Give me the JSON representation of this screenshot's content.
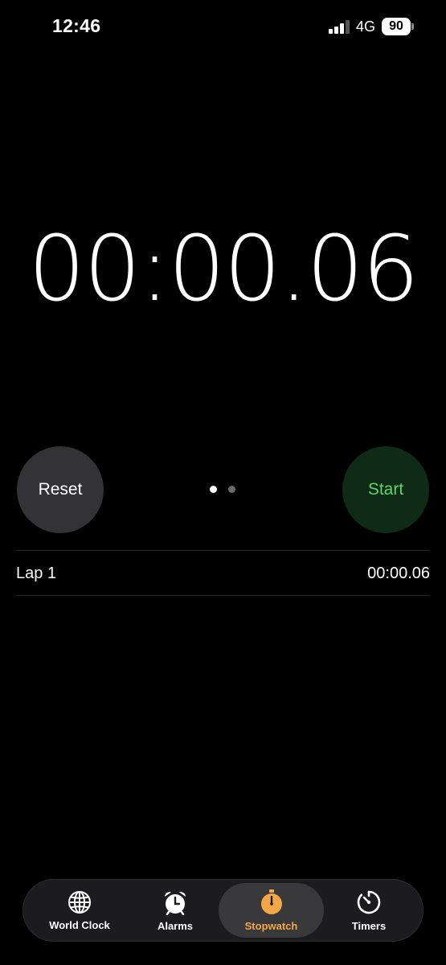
{
  "status_bar": {
    "time": "12:46",
    "network": "4G",
    "battery": "90"
  },
  "stopwatch": {
    "display": "00:00.06",
    "reset_label": "Reset",
    "start_label": "Start"
  },
  "laps": [
    {
      "label": "Lap 1",
      "time": "00:00.06"
    }
  ],
  "tab_bar": {
    "tabs": [
      {
        "label": "World Clock",
        "icon": "globe-icon"
      },
      {
        "label": "Alarms",
        "icon": "alarm-clock-icon"
      },
      {
        "label": "Stopwatch",
        "icon": "stopwatch-icon",
        "active": true
      },
      {
        "label": "Timers",
        "icon": "timer-icon"
      }
    ]
  },
  "colors": {
    "accent": "#f3a847",
    "start_text": "#5ed36f",
    "start_bg": "#0f2a15",
    "reset_bg": "#333335"
  }
}
